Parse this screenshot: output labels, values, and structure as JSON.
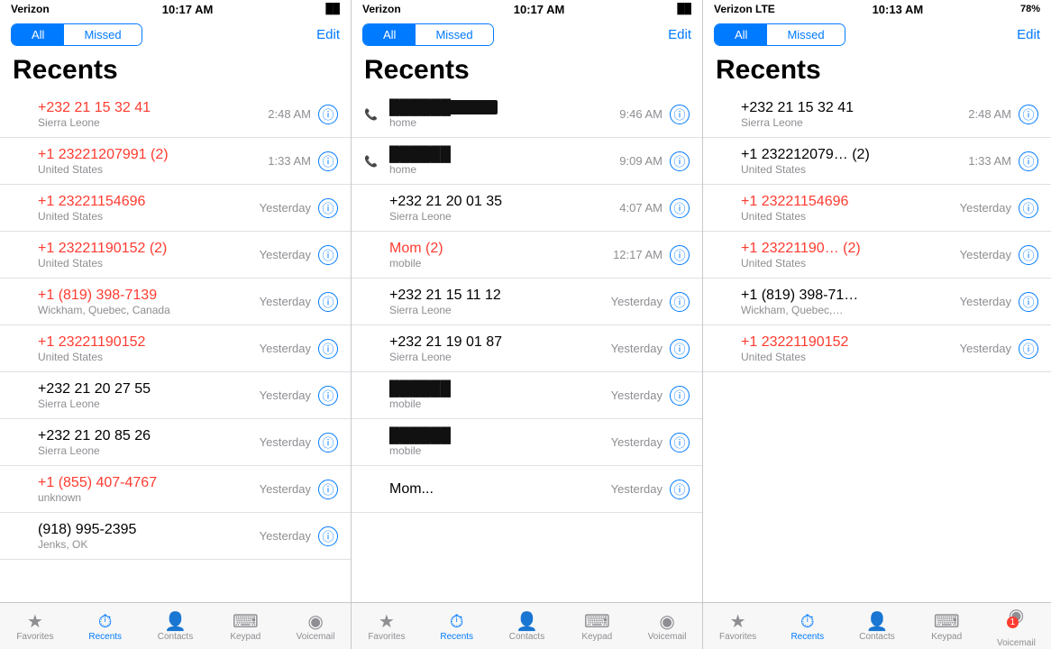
{
  "panels": [
    {
      "id": "left",
      "statusBar": {
        "carrier": "Verizon",
        "wifi": "📶",
        "time": "10:17 AM",
        "battery": "██"
      },
      "segment": {
        "all": "All",
        "missed": "Missed",
        "active": "all"
      },
      "editLabel": "Edit",
      "title": "Recents",
      "calls": [
        {
          "name": "+232 21 15 32 41",
          "sub": "Sierra Leone",
          "time": "2:48 AM",
          "missed": true
        },
        {
          "name": "+1 23221207991 (2)",
          "sub": "United States",
          "time": "1:33 AM",
          "missed": true
        },
        {
          "name": "+1 23221154696",
          "sub": "United States",
          "time": "Yesterday",
          "missed": true
        },
        {
          "name": "+1 23221190152 (2)",
          "sub": "United States",
          "time": "Yesterday",
          "missed": true
        },
        {
          "name": "+1 (819) 398-7139",
          "sub": "Wickham, Quebec, Canada",
          "time": "Yesterday",
          "missed": true
        },
        {
          "name": "+1 23221190152",
          "sub": "United States",
          "time": "Yesterday",
          "missed": true
        },
        {
          "name": "+232 21 20 27 55",
          "sub": "Sierra Leone",
          "time": "Yesterday",
          "missed": false
        },
        {
          "name": "+232 21 20 85 26",
          "sub": "Sierra Leone",
          "time": "Yesterday",
          "missed": false
        },
        {
          "name": "+1 (855) 407-4767",
          "sub": "unknown",
          "time": "Yesterday",
          "missed": true
        },
        {
          "name": "(918) 995-2395",
          "sub": "Jenks, OK",
          "time": "Yesterday",
          "missed": false
        }
      ],
      "tabs": [
        {
          "icon": "★",
          "label": "Favorites",
          "active": false
        },
        {
          "icon": "🕐",
          "label": "Recents",
          "active": true
        },
        {
          "icon": "👤",
          "label": "Contacts",
          "active": false
        },
        {
          "icon": "⌨",
          "label": "Keypad",
          "active": false
        },
        {
          "icon": "⏯",
          "label": "Voicemail",
          "active": false
        }
      ]
    },
    {
      "id": "mid",
      "statusBar": {
        "carrier": "Verizon",
        "wifi": "📶",
        "time": "10:17 AM",
        "battery": "██"
      },
      "segment": {
        "all": "All",
        "missed": "Missed",
        "active": "all"
      },
      "editLabel": "Edit",
      "title": "Recents",
      "calls": [
        {
          "name": "REDACTED_LONG",
          "sub": "home",
          "time": "9:46 AM",
          "missed": false,
          "redacted": true,
          "redactedWidth": 120
        },
        {
          "name": "REDACTED_SHORT",
          "sub": "home",
          "time": "9:09 AM",
          "missed": false,
          "redacted": true,
          "redactedWidth": 50
        },
        {
          "name": "+232 21 20 01 35",
          "sub": "Sierra Leone",
          "time": "4:07 AM",
          "missed": false
        },
        {
          "name": "Mom (2)",
          "sub": "mobile",
          "time": "12:17 AM",
          "missed": true
        },
        {
          "name": "+232 21 15 11 12",
          "sub": "Sierra Leone",
          "time": "Yesterday",
          "missed": false
        },
        {
          "name": "+232 21 19 01 87",
          "sub": "Sierra Leone",
          "time": "Yesterday",
          "missed": false
        },
        {
          "name": "REDACTED_MED",
          "sub": "mobile",
          "time": "Yesterday",
          "missed": false,
          "redacted": true,
          "redactedWidth": 50
        },
        {
          "name": "REDACTED_MED2",
          "sub": "mobile",
          "time": "Yesterday",
          "missed": false,
          "redacted": true,
          "redactedWidth": 60
        },
        {
          "name": "Mom...",
          "sub": "",
          "time": "Yesterday",
          "missed": false
        }
      ],
      "tabs": [
        {
          "icon": "★",
          "label": "Favorites",
          "active": false
        },
        {
          "icon": "🕐",
          "label": "Recents",
          "active": true
        },
        {
          "icon": "👤",
          "label": "Contacts",
          "active": false
        },
        {
          "icon": "⌨",
          "label": "Keypad",
          "active": false
        },
        {
          "icon": "⏯",
          "label": "Voicemail",
          "active": false
        }
      ]
    },
    {
      "id": "right",
      "statusBar": {
        "carrier": "Verizon LTE",
        "time": "10:13 AM",
        "battery": "78%"
      },
      "segment": {
        "all": "All",
        "missed": "Missed",
        "active": "all"
      },
      "editLabel": "Edit",
      "title": "Recents",
      "calls": [
        {
          "name": "+232 21 15 32 41",
          "sub": "Sierra Leone",
          "time": "2:48 AM",
          "missed": false
        },
        {
          "name": "+1 232212079… (2)",
          "sub": "United States",
          "time": "1:33 AM",
          "missed": false
        },
        {
          "name": "+1 23221154696",
          "sub": "United States",
          "time": "Yesterday",
          "missed": true
        },
        {
          "name": "+1 23221190… (2)",
          "sub": "United States",
          "time": "Yesterday",
          "missed": true
        },
        {
          "name": "+1 (819) 398-71…",
          "sub": "Wickham, Quebec,…",
          "time": "Yesterday",
          "missed": false
        },
        {
          "name": "+1 23221190152",
          "sub": "United States",
          "time": "Yesterday",
          "missed": true
        }
      ],
      "tabs": [
        {
          "icon": "★",
          "label": "Favorites",
          "active": false
        },
        {
          "icon": "🕐",
          "label": "Recents",
          "active": true
        },
        {
          "icon": "👤",
          "label": "Contacts",
          "active": false
        },
        {
          "icon": "⌨",
          "label": "Keypad",
          "active": false
        },
        {
          "icon": "⏯",
          "label": "Voicemail",
          "active": false,
          "badge": "1"
        }
      ]
    }
  ]
}
